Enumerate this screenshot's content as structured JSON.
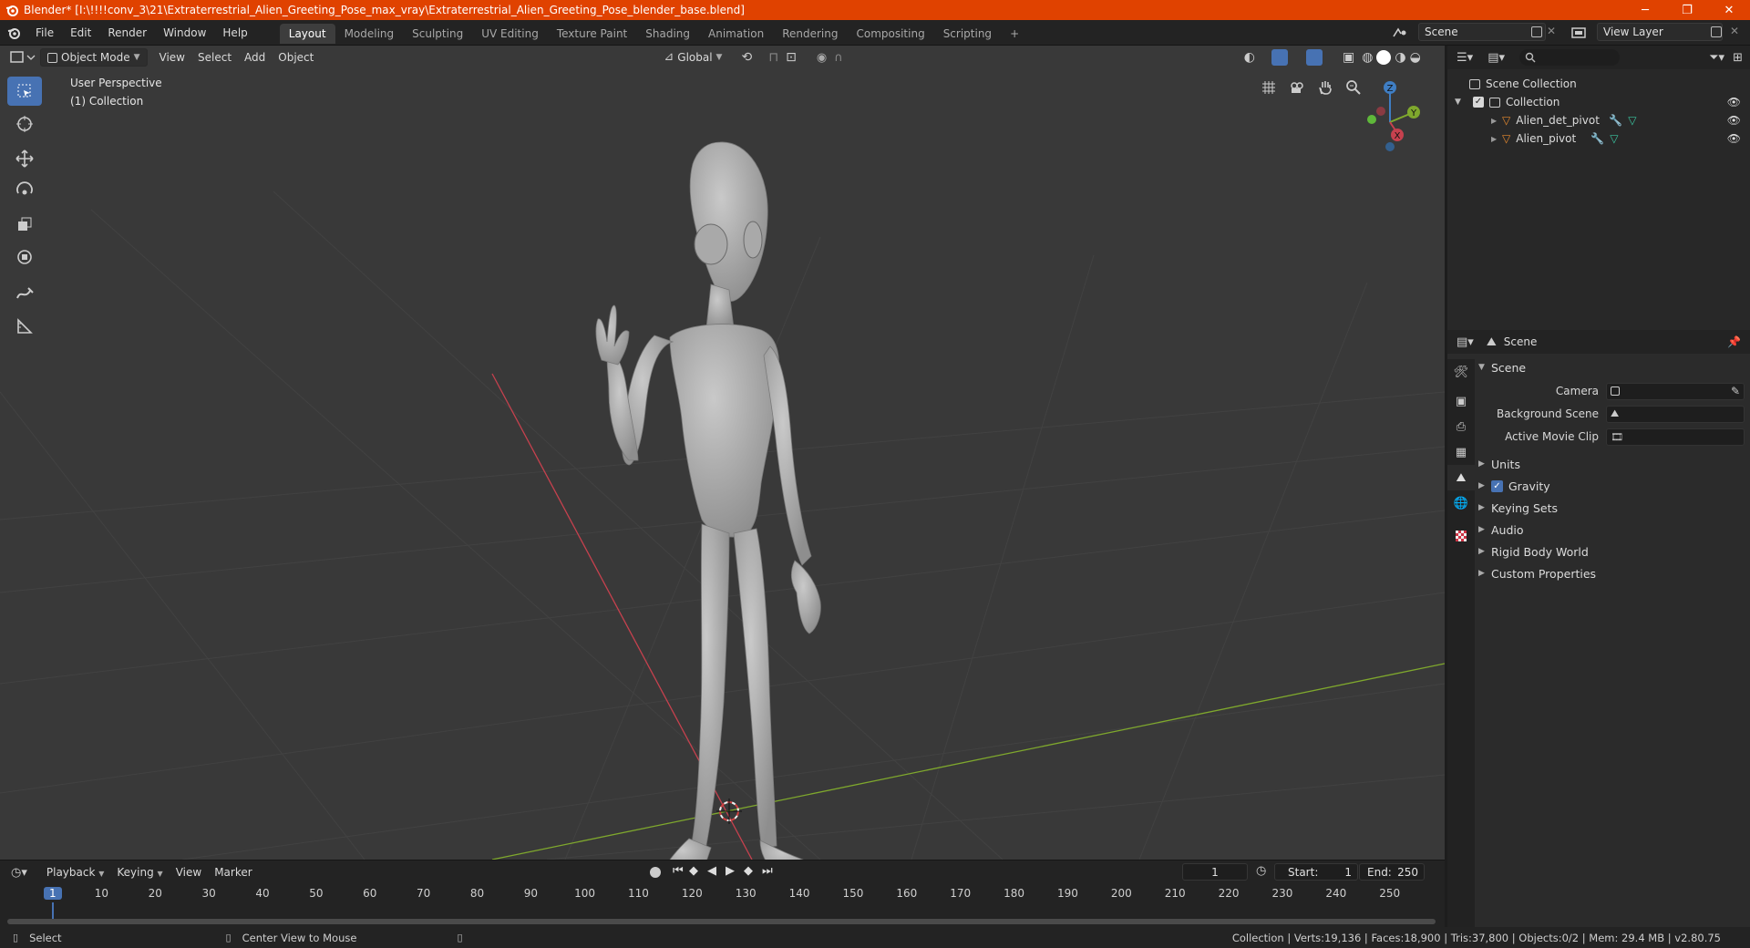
{
  "window": {
    "title": "Blender* [I:\\!!!!conv_3\\21\\Extraterrestrial_Alien_Greeting_Pose_max_vray\\Extraterrestrial_Alien_Greeting_Pose_blender_base.blend]",
    "minimize": "─",
    "maximize": "❐",
    "close": "✕"
  },
  "menu": [
    "File",
    "Edit",
    "Render",
    "Window",
    "Help"
  ],
  "workspaces": [
    "Layout",
    "Modeling",
    "Sculpting",
    "UV Editing",
    "Texture Paint",
    "Shading",
    "Animation",
    "Rendering",
    "Compositing",
    "Scripting"
  ],
  "active_workspace": "Layout",
  "add_workspace": "+",
  "scene_name": "Scene",
  "view_layer": "View Layer",
  "viewport": {
    "mode": "Object Mode",
    "menus": [
      "View",
      "Select",
      "Add",
      "Object"
    ],
    "orientation": "Global",
    "overlay_line1": "User Perspective",
    "overlay_line2": "(1) Collection"
  },
  "gizmo": {
    "z": "Z",
    "y": "Y",
    "x": "X"
  },
  "outliner": {
    "root": "Scene Collection",
    "collection": "Collection",
    "items": [
      "Alien_det_pivot",
      "Alien_pivot"
    ]
  },
  "properties": {
    "context": "Scene",
    "section": "Scene",
    "fields": [
      {
        "label": "Camera"
      },
      {
        "label": "Background Scene"
      },
      {
        "label": "Active Movie Clip"
      }
    ],
    "panels": [
      "Units",
      "Gravity",
      "Keying Sets",
      "Audio",
      "Rigid Body World",
      "Custom Properties"
    ],
    "gravity_checked": true
  },
  "timeline": {
    "menus": [
      "Playback",
      "Keying",
      "View",
      "Marker"
    ],
    "current_frame": "1",
    "start_label": "Start:",
    "start": "1",
    "end_label": "End:",
    "end": "250",
    "ruler": [
      "1",
      "10",
      "20",
      "30",
      "40",
      "50",
      "60",
      "70",
      "80",
      "90",
      "100",
      "110",
      "120",
      "130",
      "140",
      "150",
      "160",
      "170",
      "180",
      "190",
      "200",
      "210",
      "220",
      "230",
      "240",
      "250"
    ]
  },
  "status": {
    "select": "Select",
    "center": "Center View to Mouse",
    "stats": "Collection | Verts:19,136 | Faces:18,900 | Tris:37,800 | Objects:0/2 | Mem: 29.4 MB | v2.80.75"
  },
  "colors": {
    "title_bar": "#e04200",
    "accent": "#4772b3",
    "x_axis": "#c6414e",
    "y_axis": "#7fa82d",
    "z_axis": "#3f7ec4"
  }
}
